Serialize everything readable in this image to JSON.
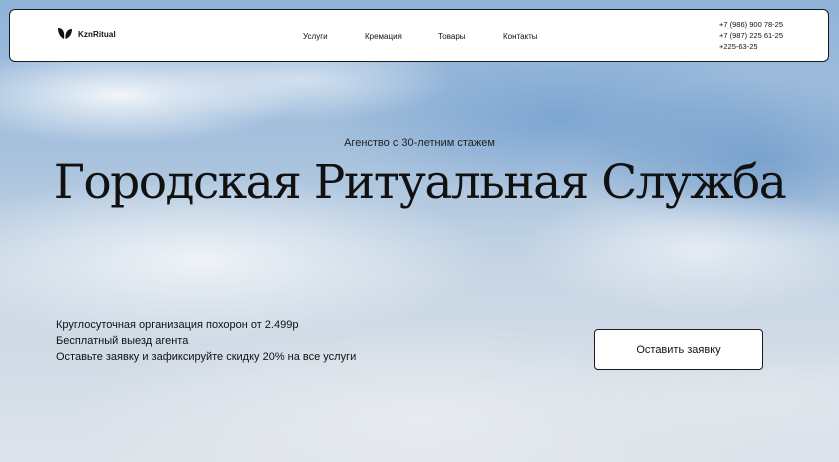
{
  "header": {
    "logo_text": "KznRitual",
    "menu": [
      {
        "label": "Услуги"
      },
      {
        "label": "Кремация"
      },
      {
        "label": "Товары"
      },
      {
        "label": "Контакты"
      }
    ],
    "phones": [
      "+7 (986) 900 78-25",
      "+7 (987) 225 61-25",
      "+225-63-25"
    ]
  },
  "hero": {
    "tagline": "Агенство с 30-летним стажем",
    "title": "Городская Ритуальная Служба",
    "features": [
      "Круглосуточная организация похорон от 2.499р",
      "Бесплатный выезд агента",
      "Оставьте заявку и зафиксируйте скидку 20% на все услуги"
    ],
    "cta_label": "Оставить заявку"
  },
  "colors": {
    "accent": "#111111",
    "sky": "#8fb3d9",
    "nav_background": "#ffffff"
  },
  "icons": {
    "logo": "leaf-icon"
  }
}
